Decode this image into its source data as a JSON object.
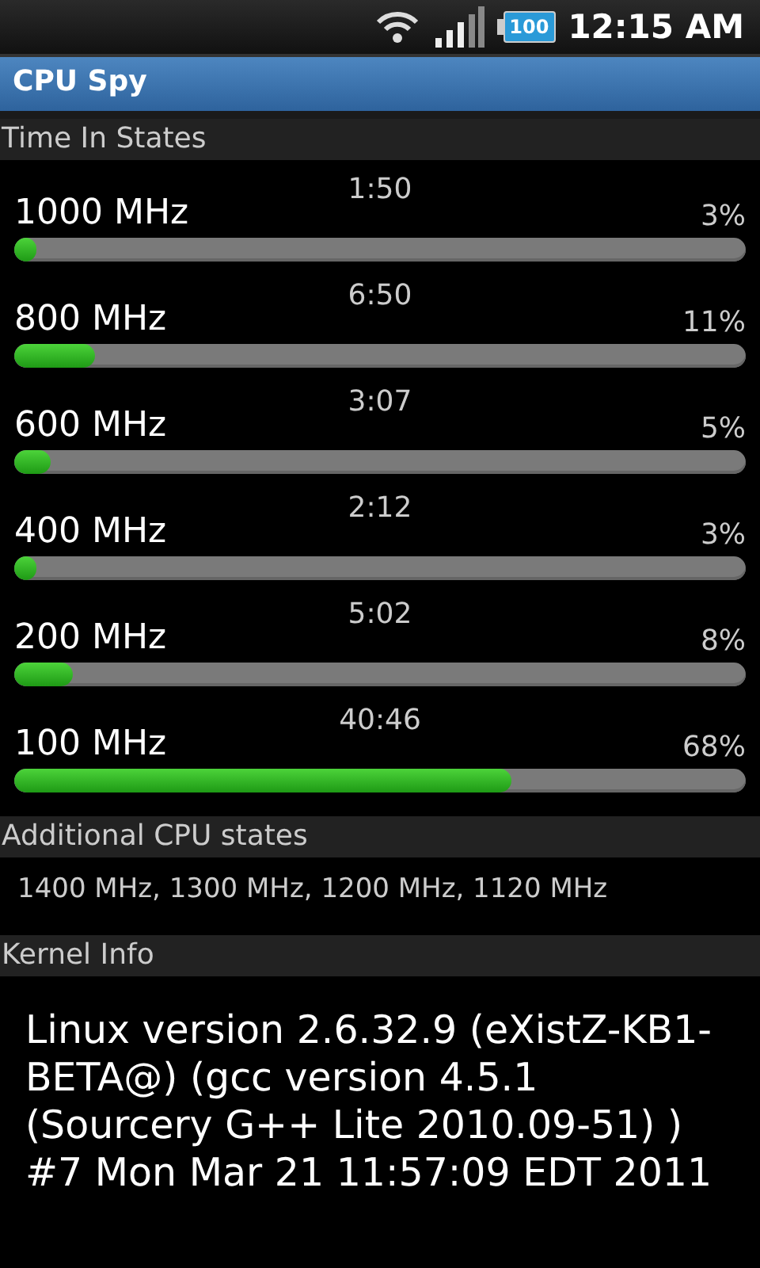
{
  "status_bar": {
    "battery": "100",
    "time": "12:15 AM"
  },
  "window": {
    "title": "CPU Spy"
  },
  "time_in_states": {
    "header": "Time In States",
    "states": [
      {
        "frequency": "1000 MHz",
        "time": "1:50",
        "percent": "3%",
        "level": 0.03
      },
      {
        "frequency": "800 MHz",
        "time": "6:50",
        "percent": "11%",
        "level": 0.11
      },
      {
        "frequency": "600 MHz",
        "time": "3:07",
        "percent": "5%",
        "level": 0.05
      },
      {
        "frequency": "400 MHz",
        "time": "2:12",
        "percent": "3%",
        "level": 0.03
      },
      {
        "frequency": "200 MHz",
        "time": "5:02",
        "percent": "8%",
        "level": 0.08
      },
      {
        "frequency": "100 MHz",
        "time": "40:46",
        "percent": "68%",
        "level": 0.68
      }
    ]
  },
  "additional_cpu_states": {
    "header": "Additional CPU states",
    "text": "1400 MHz, 1300 MHz, 1200 MHz, 1120 MHz"
  },
  "kernel_info": {
    "header": "Kernel Info",
    "text": "Linux version 2.6.32.9 (eXistZ-KB1-BETA@) (gcc version 4.5.1 (Sourcery G++ Lite 2010.09-51) ) #7 Mon Mar 21 11:57:09 EDT 2011"
  }
}
